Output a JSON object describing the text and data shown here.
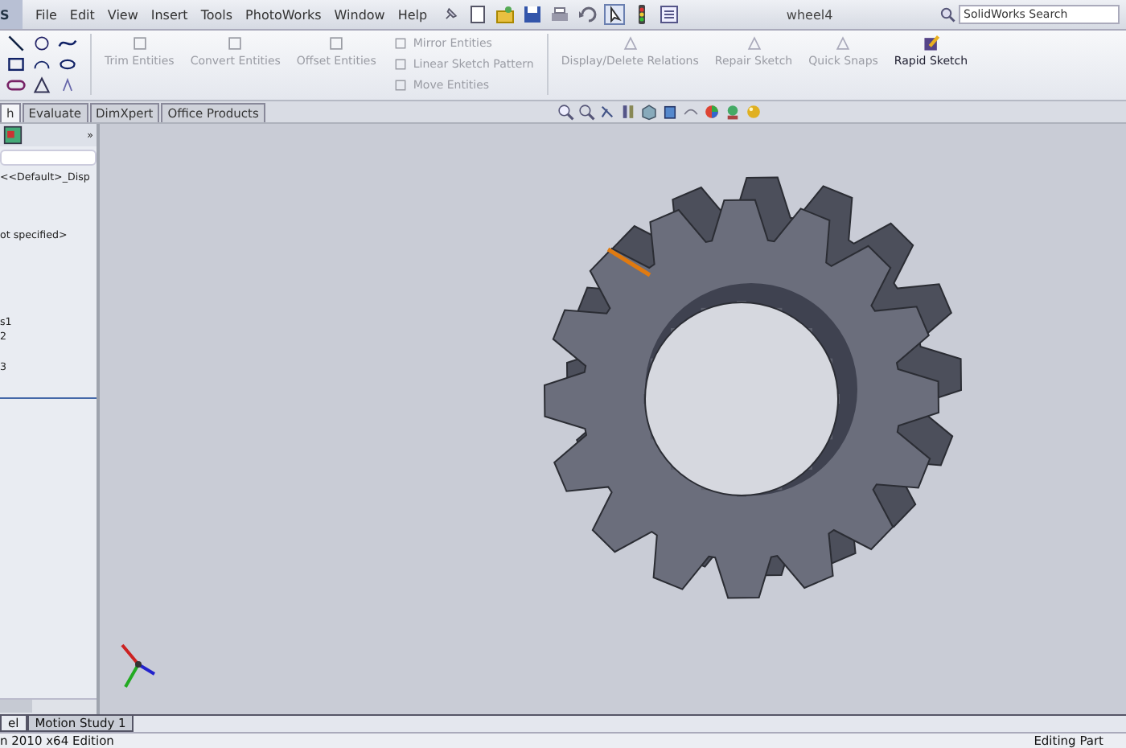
{
  "app_logo": "S",
  "menu": [
    "File",
    "Edit",
    "View",
    "Insert",
    "Tools",
    "PhotoWorks",
    "Window",
    "Help"
  ],
  "window": {
    "title": "wheel4"
  },
  "search": {
    "placeholder": "SolidWorks Search"
  },
  "ribbon": {
    "large_buttons": [
      {
        "label": "Trim Entities",
        "disabled": true
      },
      {
        "label": "Convert Entities",
        "disabled": true
      },
      {
        "label": "Offset Entities",
        "disabled": true
      }
    ],
    "small_buttons": [
      {
        "label": "Mirror Entities",
        "disabled": true
      },
      {
        "label": "Linear Sketch Pattern",
        "disabled": true
      },
      {
        "label": "Move Entities",
        "disabled": true
      }
    ],
    "right_buttons": [
      {
        "label": "Display/Delete Relations",
        "disabled": true
      },
      {
        "label": "Repair Sketch",
        "disabled": true
      },
      {
        "label": "Quick Snaps",
        "disabled": true
      },
      {
        "label": "Rapid Sketch",
        "disabled": false
      }
    ]
  },
  "command_tabs": [
    {
      "label": "h",
      "selected": true
    },
    {
      "label": "Evaluate",
      "selected": false
    },
    {
      "label": "DimXpert",
      "selected": false
    },
    {
      "label": "Office Products",
      "selected": false
    }
  ],
  "panel": {
    "expand": "»",
    "tree": [
      "<<Default>_Disp",
      "ot specified>",
      "s1",
      "2",
      "3"
    ]
  },
  "bottom_tabs": [
    {
      "label": "el",
      "selected": true
    },
    {
      "label": "Motion Study 1",
      "selected": false
    }
  ],
  "status_bar": {
    "left": "n 2010 x64 Edition",
    "right": "Editing Part"
  }
}
